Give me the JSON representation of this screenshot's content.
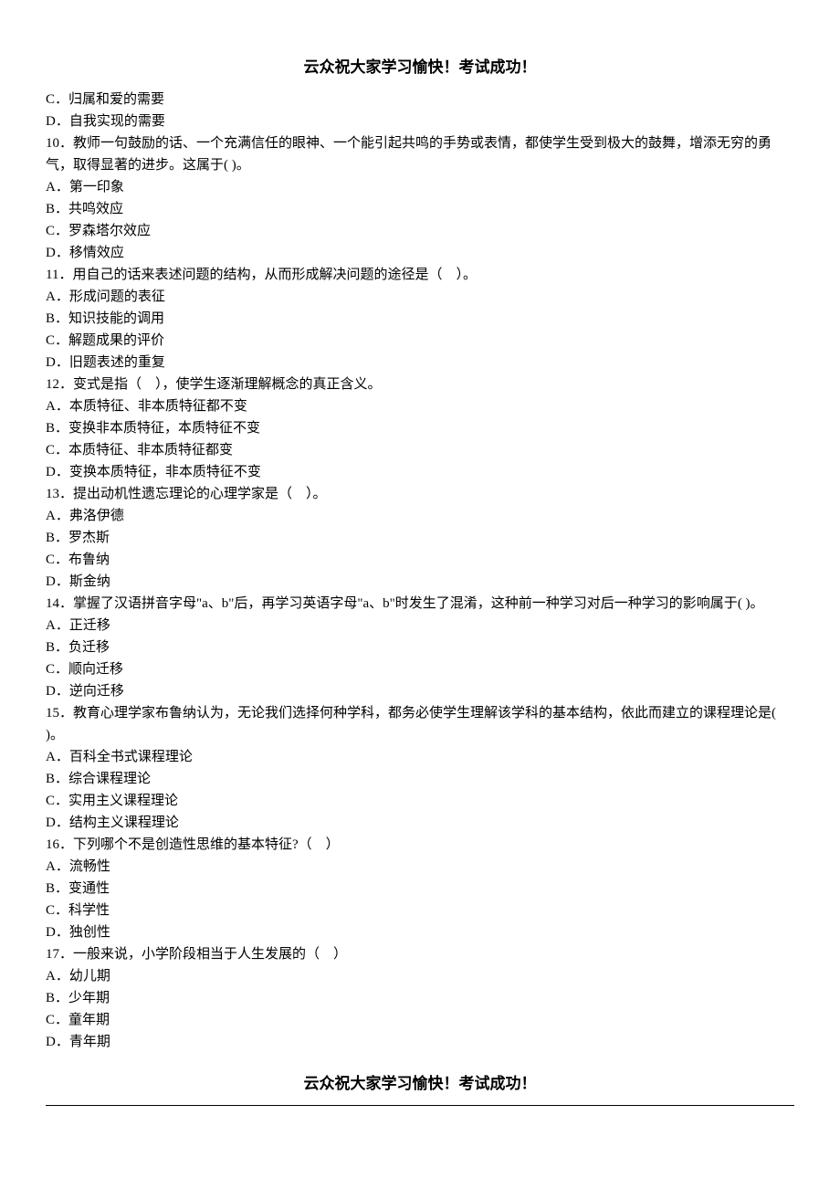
{
  "header": "云众祝大家学习愉快！考试成功！",
  "footer": "云众祝大家学习愉快！考试成功！",
  "precontent": [
    "C．归属和爱的需要",
    "D．自我实现的需要"
  ],
  "questions": [
    {
      "stem": "10．教师一句鼓励的话、一个充满信任的眼神、一个能引起共鸣的手势或表情，都使学生受到极大的鼓舞，增添无穷的勇气，取得显著的进步。这属于( )。",
      "options": [
        "A．第一印象",
        "B．共鸣效应",
        "C．罗森塔尔效应",
        "D．移情效应"
      ]
    },
    {
      "stem": "11．用自己的话来表述问题的结构，从而形成解决问题的途径是（　）。",
      "options": [
        "A．形成问题的表征",
        "B．知识技能的调用",
        "C．解题成果的评价",
        "D．旧题表述的重复"
      ]
    },
    {
      "stem": "12．变式是指（　），使学生逐渐理解概念的真正含义。",
      "options": [
        "A．本质特征、非本质特征都不变",
        "B．变换非本质特征，本质特征不变",
        "C．本质特征、非本质特征都变",
        "D．变换本质特征，非本质特征不变"
      ]
    },
    {
      "stem": "13．提出动机性遗忘理论的心理学家是（　）。",
      "options": [
        "A．弗洛伊德",
        "B．罗杰斯",
        "C．布鲁纳",
        "D．斯金纳"
      ]
    },
    {
      "stem": "14．掌握了汉语拼音字母\"a、b\"后，再学习英语字母\"a、b\"时发生了混淆，这种前一种学习对后一种学习的影响属于( )。",
      "options": [
        "A．正迁移",
        "B．负迁移",
        "C．顺向迁移",
        "D．逆向迁移"
      ]
    },
    {
      "stem": "15．教育心理学家布鲁纳认为，无论我们选择何种学科，都务必使学生理解该学科的基本结构，依此而建立的课程理论是( )。",
      "options": [
        "A．百科全书式课程理论",
        "B．综合课程理论",
        "C．实用主义课程理论",
        "D．结构主义课程理论"
      ]
    },
    {
      "stem": "16．下列哪个不是创造性思维的基本特征?（　）",
      "options": [
        "A．流畅性",
        "B．变通性",
        "C．科学性",
        "D．独创性"
      ]
    },
    {
      "stem": "17．一般来说，小学阶段相当于人生发展的（　）",
      "options": [
        "A．幼儿期",
        "B．少年期",
        "C．童年期",
        "D．青年期"
      ]
    }
  ]
}
